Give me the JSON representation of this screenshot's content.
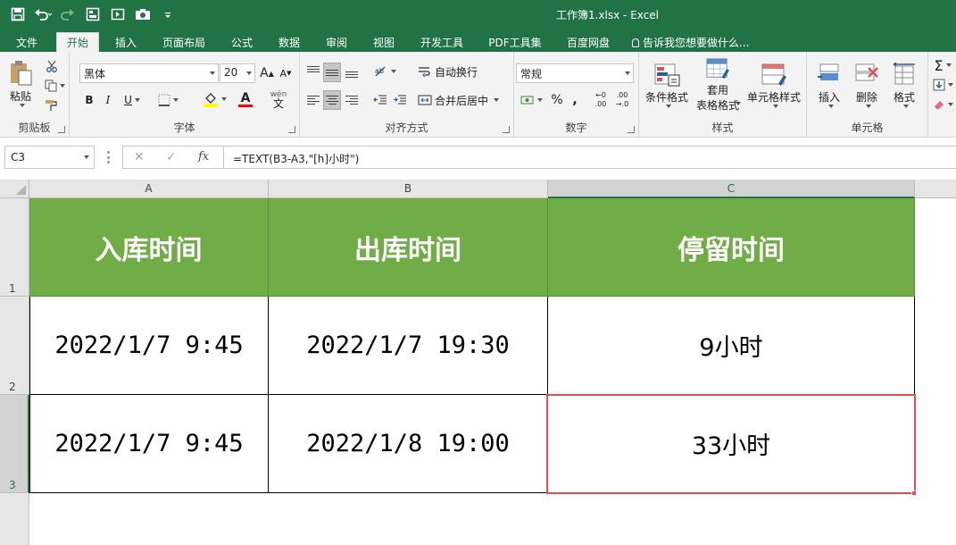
{
  "window": {
    "title": "工作簿1.xlsx  -  Excel"
  },
  "quick_access": [
    "save-icon",
    "undo-icon",
    "redo-icon",
    "form-icon",
    "screen-icon",
    "camera-icon",
    "customize-icon"
  ],
  "tabs": [
    {
      "label": "文件"
    },
    {
      "label": "开始"
    },
    {
      "label": "插入"
    },
    {
      "label": "页面布局"
    },
    {
      "label": "公式"
    },
    {
      "label": "数据"
    },
    {
      "label": "审阅"
    },
    {
      "label": "视图"
    },
    {
      "label": "开发工具"
    },
    {
      "label": "PDF工具集"
    },
    {
      "label": "百度网盘"
    }
  ],
  "tell_me": "告诉我您想要做什么...",
  "ribbon": {
    "clipboard": {
      "paste": "粘贴",
      "label": "剪贴板"
    },
    "font": {
      "name": "黑体",
      "size": "20",
      "bold": "B",
      "italic": "I",
      "underline": "U",
      "grow": "A",
      "shrink": "A",
      "phonetic_top": "wén",
      "phonetic_bottom": "文",
      "color_letter": "A",
      "label": "字体"
    },
    "alignment": {
      "wrap": "自动换行",
      "merge": "合并后居中",
      "label": "对齐方式"
    },
    "number": {
      "format": "常规",
      "percent": "%",
      "comma": ",",
      "inc_top": "←0",
      "inc_bottom": ".00",
      "dec_top": ".00",
      "dec_bottom": "→.0",
      "label": "数字"
    },
    "styles": {
      "conditional": "条件格式",
      "table_top": "套用",
      "table_bottom": "表格格式",
      "cell_styles": "单元格样式",
      "label": "样式"
    },
    "cells": {
      "insert": "插入",
      "delete": "删除",
      "format": "格式",
      "label": "单元格"
    }
  },
  "formula_bar": {
    "name_box": "C3",
    "cancel": "✕",
    "enter": "✓",
    "fx": "fx",
    "formula": "=TEXT(B3-A3,\"[h]小时\")"
  },
  "sheet": {
    "columns": [
      "A",
      "B",
      "C"
    ],
    "rows": [
      "1",
      "2",
      "3"
    ],
    "header": [
      "入库时间",
      "出库时间",
      "停留时间"
    ],
    "data": [
      [
        "2022/1/7 9:45",
        "2022/1/7 19:30",
        "9小时"
      ],
      [
        "2022/1/7 9:45",
        "2022/1/8 19:00",
        "33小时"
      ]
    ],
    "header_color": "#70ad47",
    "selection_color": "#e84b4b",
    "selected_cell": "C3"
  }
}
